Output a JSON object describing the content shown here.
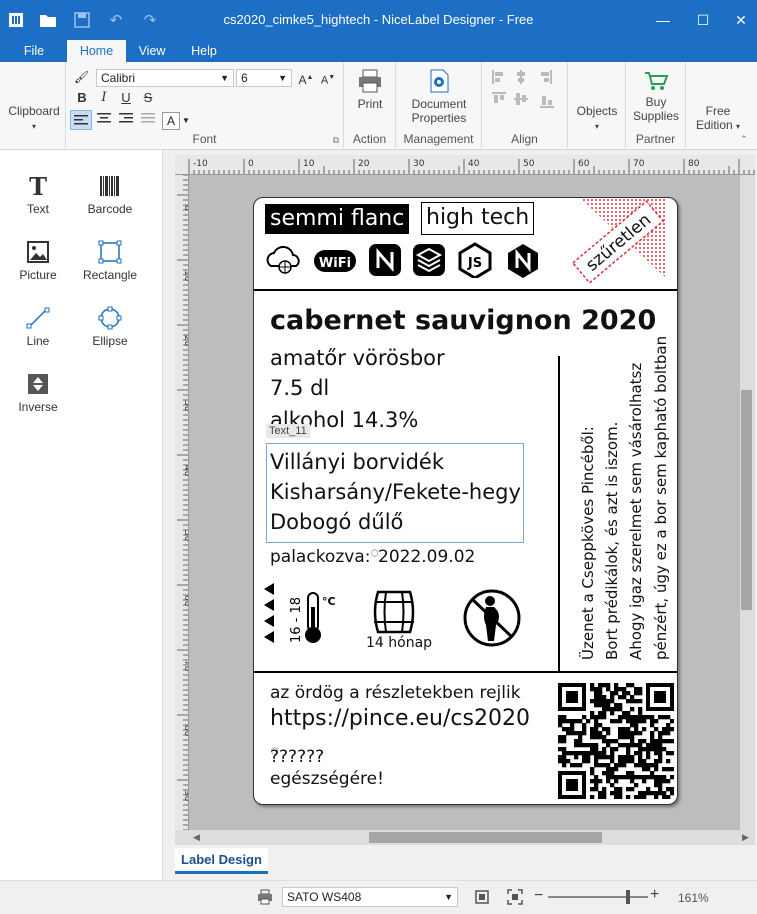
{
  "window": {
    "title": "cs2020_cimke5_hightech - NiceLabel Designer - Free"
  },
  "menu_tabs": [
    "File",
    "Home",
    "View",
    "Help"
  ],
  "ribbon": {
    "clipboard_label": "Clipboard",
    "font_name": "Calibri",
    "font_size": "6",
    "font_group_label": "Font",
    "print_label": "Print",
    "action_label": "Action",
    "doc_props_line1": "Document",
    "doc_props_line2": "Properties",
    "management_label": "Management",
    "align_label": "Align",
    "objects_label": "Objects",
    "buy_line1": "Buy",
    "buy_line2": "Supplies",
    "partner_label": "Partner",
    "free_line1": "Free",
    "free_line2": "Edition",
    "text_color_letter": "A"
  },
  "tools": [
    {
      "label": "Text",
      "icon": "text-icon"
    },
    {
      "label": "Barcode",
      "icon": "barcode-icon"
    },
    {
      "label": "Picture",
      "icon": "picture-icon"
    },
    {
      "label": "Rectangle",
      "icon": "rectangle-icon"
    },
    {
      "label": "Line",
      "icon": "line-icon"
    },
    {
      "label": "Ellipse",
      "icon": "ellipse-icon"
    },
    {
      "label": "Inverse",
      "icon": "inverse-icon"
    }
  ],
  "ruler": {
    "h_ticks": [
      "-10",
      "0",
      "10",
      "20",
      "30",
      "40",
      "50",
      "60",
      "70",
      "80"
    ],
    "v_ticks": [
      "0",
      "10",
      "20",
      "30",
      "40",
      "50",
      "60",
      "70",
      "80",
      "90",
      "100"
    ]
  },
  "label": {
    "brand_black": "semmi flanc",
    "brand_white": "high tech",
    "stamp": "szűretlen",
    "wine_name": "cabernet sauvignon 2020",
    "type": "amatőr vörösbor",
    "volume": "7.5 dl",
    "alcohol": "alkohol 14.3%",
    "selected_tag": "Text_11",
    "region_line1": "Villányi borvidék",
    "region_line2": "Kisharsány/Fekete-hegy",
    "region_line3": "Dobogó dűlő",
    "bottled_label": "palackozva:",
    "bottled_date": "2022.09.02",
    "temp_range": "16 - 18",
    "temp_unit": "°C",
    "barrel_text": "14 hónap",
    "side_line1": "Üzenet a Cseppköves Pincéből:",
    "side_line2": "Bort prédikálok, és azt is iszom.",
    "side_line3": "Ahogy igaz szerelmet sem vásárolhatsz",
    "side_line4": "pénzért, úgy ez a bor sem kapható boltban",
    "motto": "az ördög a részletekben rejlik",
    "url": "https://pince.eu/cs2020",
    "question": "??????",
    "cheers": "egészségére!"
  },
  "status": {
    "label_design_tab": "Label Design",
    "printer": "SATO WS408",
    "zoom": "161%"
  },
  "colors": {
    "accent": "#1c6fc4",
    "stamp_red": "#e0303a"
  }
}
